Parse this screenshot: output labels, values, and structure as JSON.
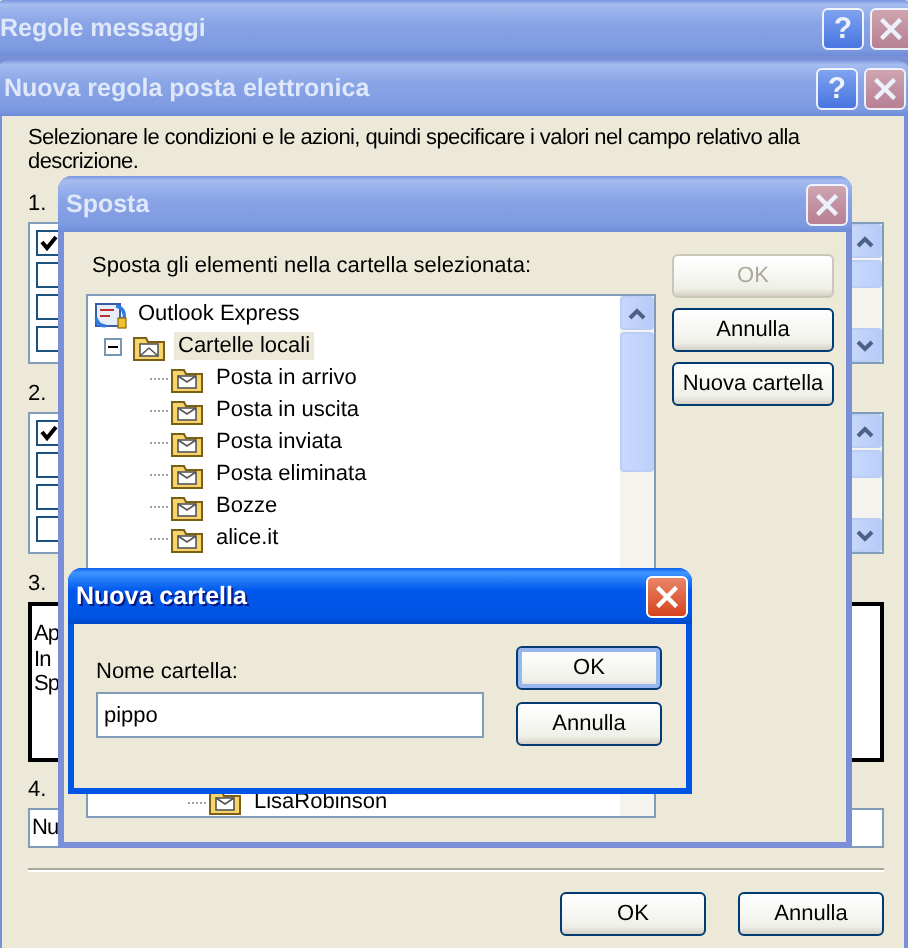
{
  "main_window": {
    "title": "Regole messaggi",
    "active": false,
    "help": "?"
  },
  "rule_dialog": {
    "title": "Nuova regola posta elettronica",
    "active": false,
    "help": "?",
    "instructions": "Selezionare le condizioni e le azioni, quindi specificare i valori nel campo relativo alla descrizione.",
    "conditions": {
      "label": "1.",
      "items": [
        {
          "checked": true
        },
        {
          "checked": false
        },
        {
          "checked": false
        },
        {
          "checked": false
        }
      ]
    },
    "actions": {
      "label": "2.",
      "items": [
        {
          "checked": true
        },
        {
          "checked": false
        },
        {
          "checked": false
        },
        {
          "checked": false
        }
      ]
    },
    "description": {
      "label": "3.",
      "lines": [
        "Ap",
        "In",
        "Sp"
      ]
    },
    "rule_name": {
      "label": "4.",
      "value": "Nu"
    },
    "buttons": [
      {
        "label": "OK"
      },
      {
        "label": "Annulla"
      }
    ]
  },
  "move_dialog": {
    "title": "Sposta",
    "active": false,
    "prompt": "Sposta gli elementi nella cartella selezionata:",
    "folders": [
      {
        "name": "Outlook Express",
        "kind": "program",
        "selected": false,
        "children": [
          {
            "name": "Cartelle locali",
            "kind": "folder",
            "expanded": true,
            "selected": true,
            "children": [
              {
                "name": "Posta in arrivo",
                "kind": "folder",
                "selected": false
              },
              {
                "name": "Posta in uscita",
                "kind": "folder",
                "selected": false
              },
              {
                "name": "Posta inviata",
                "kind": "folder",
                "selected": false
              },
              {
                "name": "Posta eliminata",
                "kind": "folder",
                "selected": false
              },
              {
                "name": "Bozze",
                "kind": "folder",
                "selected": false
              },
              {
                "name": "alice.it",
                "kind": "folder",
                "selected": false,
                "children": [
                  {
                    "name": "LisaRobinson",
                    "kind": "folder",
                    "selected": false
                  }
                ]
              }
            ]
          }
        ]
      }
    ],
    "buttons": [
      {
        "label": "OK",
        "disabled": true
      },
      {
        "label": "Annulla",
        "disabled": false
      },
      {
        "label": "Nuova cartella",
        "disabled": false
      }
    ]
  },
  "new_folder_dialog": {
    "title": "Nuova cartella",
    "active": true,
    "field_label": "Nome cartella:",
    "value": "pippo",
    "buttons": [
      {
        "label": "OK",
        "default": true
      },
      {
        "label": "Annulla",
        "default": false
      }
    ]
  }
}
